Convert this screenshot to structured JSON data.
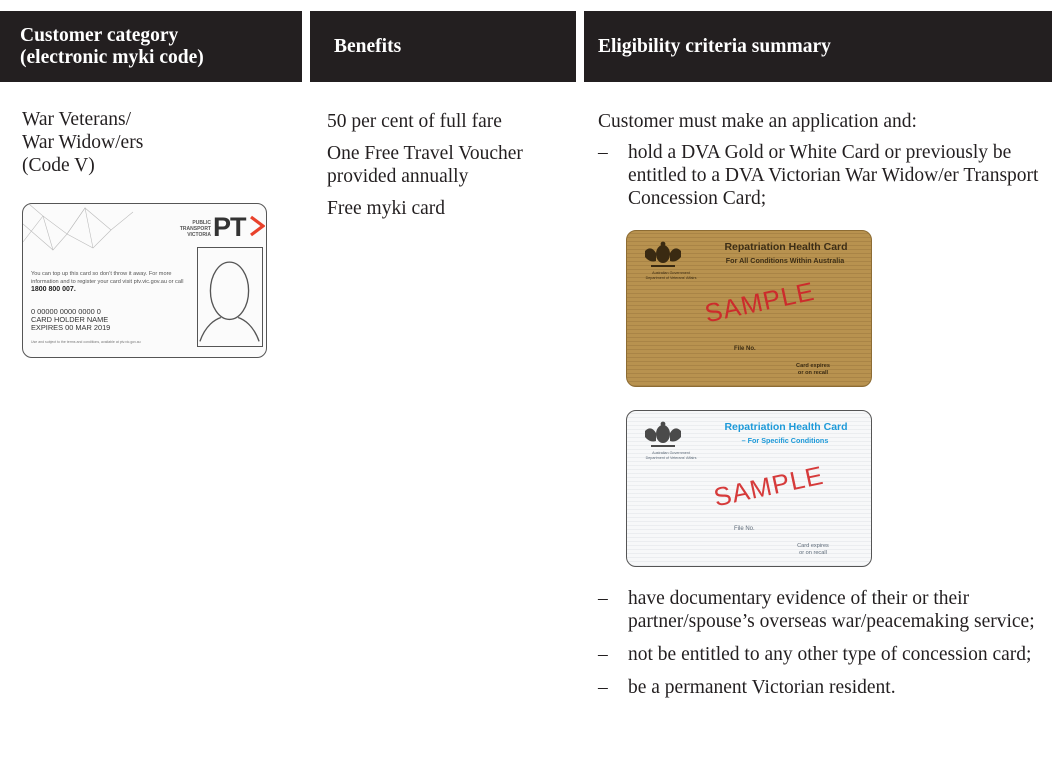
{
  "headers": {
    "category": "Customer category\n(electronic myki code)",
    "benefits": "Benefits",
    "eligibility": "Eligibility criteria summary"
  },
  "category": {
    "lines": [
      "War Veterans/",
      "War Widow/ers",
      "(Code V)"
    ]
  },
  "benefits": [
    "50 per cent of full fare",
    "One Free Travel Voucher provided annually",
    "Free myki card"
  ],
  "eligibility": {
    "intro": "Customer must make an application and:",
    "criteria_top": [
      "hold a DVA Gold or White Card or previously be entitled to a DVA Victorian War Widow/er Transport Concession Card;"
    ],
    "criteria_bottom": [
      "have documentary evidence of their or their partner/spouse’s overseas war/peacemaking service;",
      "not be entitled to any other type of concession card;",
      "be a permanent Victorian resident."
    ],
    "dash": "–"
  },
  "myki_card": {
    "brand_small": "PUBLIC TRANSPORT VICTORIA",
    "brand_logo": "PT",
    "instruction": "You can top up this card so don’t throw it away. For more information and to register your card visit ptv.vic.gov.au or call",
    "phone": "1800 800 007.",
    "card_number": "0 00000 0000 0000 0",
    "holder": "CARD HOLDER NAME",
    "expires": "EXPIRES 00 MAR 2019",
    "fine_print": "Use and subject to the terms and conditions, available at ptv.vic.gov.au",
    "accent_color": "#e8412b"
  },
  "gold_card": {
    "title": "Repatriation Health Card",
    "subtitle": "For All Conditions Within Australia",
    "government": "Australian Government\nDepartment of Veterans' Affairs",
    "stamp": "SAMPLE",
    "file_no": "File No.",
    "expiry": "Card expires\nor on recall",
    "color": "#b8924f"
  },
  "white_card": {
    "title": "Repatriation Health Card",
    "subtitle": "– For Specific Conditions",
    "government": "Australian Government\nDepartment of Veterans' Affairs",
    "stamp": "SAMPLE",
    "file_no": "File No.",
    "expiry": "Card expires\nor on recall",
    "color": "#1e9ad9"
  }
}
